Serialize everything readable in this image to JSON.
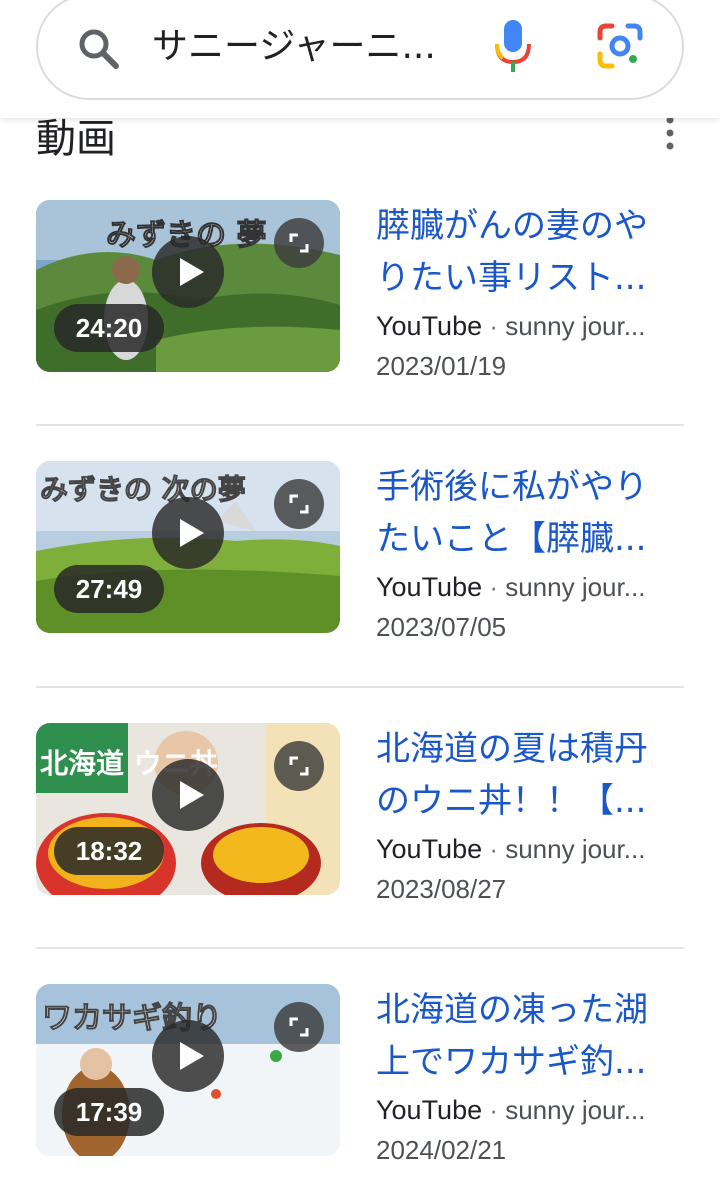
{
  "search": {
    "query": "サニージャーニ..."
  },
  "section": {
    "title": "動画"
  },
  "videos": [
    {
      "title": "膵臓がんの妻のやりたい事リスト...",
      "source": "YouTube",
      "channel": "sunny jour...",
      "date": "2023/01/19",
      "duration": "24:20",
      "thumb_text": "みずきの 夢"
    },
    {
      "title": "手術後に私がやりたいこと【膵臓...",
      "source": "YouTube",
      "channel": "sunny jour...",
      "date": "2023/07/05",
      "duration": "27:49",
      "thumb_text": "みずきの 次の夢"
    },
    {
      "title": "北海道の夏は積丹のウニ丼！！【...",
      "source": "YouTube",
      "channel": "sunny jour...",
      "date": "2023/08/27",
      "duration": "18:32",
      "thumb_text": "北海道 ウニ丼"
    },
    {
      "title": "北海道の凍った湖上でワカサギ釣...",
      "source": "YouTube",
      "channel": "sunny jour...",
      "date": "2024/02/21",
      "duration": "17:39",
      "thumb_text": "ワカサギ釣り"
    }
  ],
  "meta_separator": " · ",
  "colors": {
    "link": "#1a57c8",
    "meta": "#4d5156",
    "google_blue": "#4285f4",
    "google_red": "#ea4335",
    "google_yellow": "#fbbc05",
    "google_green": "#34a853"
  },
  "icons": [
    "search-icon",
    "mic-icon",
    "google-lens-icon",
    "more-vert-icon",
    "play-icon",
    "expand-icon"
  ]
}
